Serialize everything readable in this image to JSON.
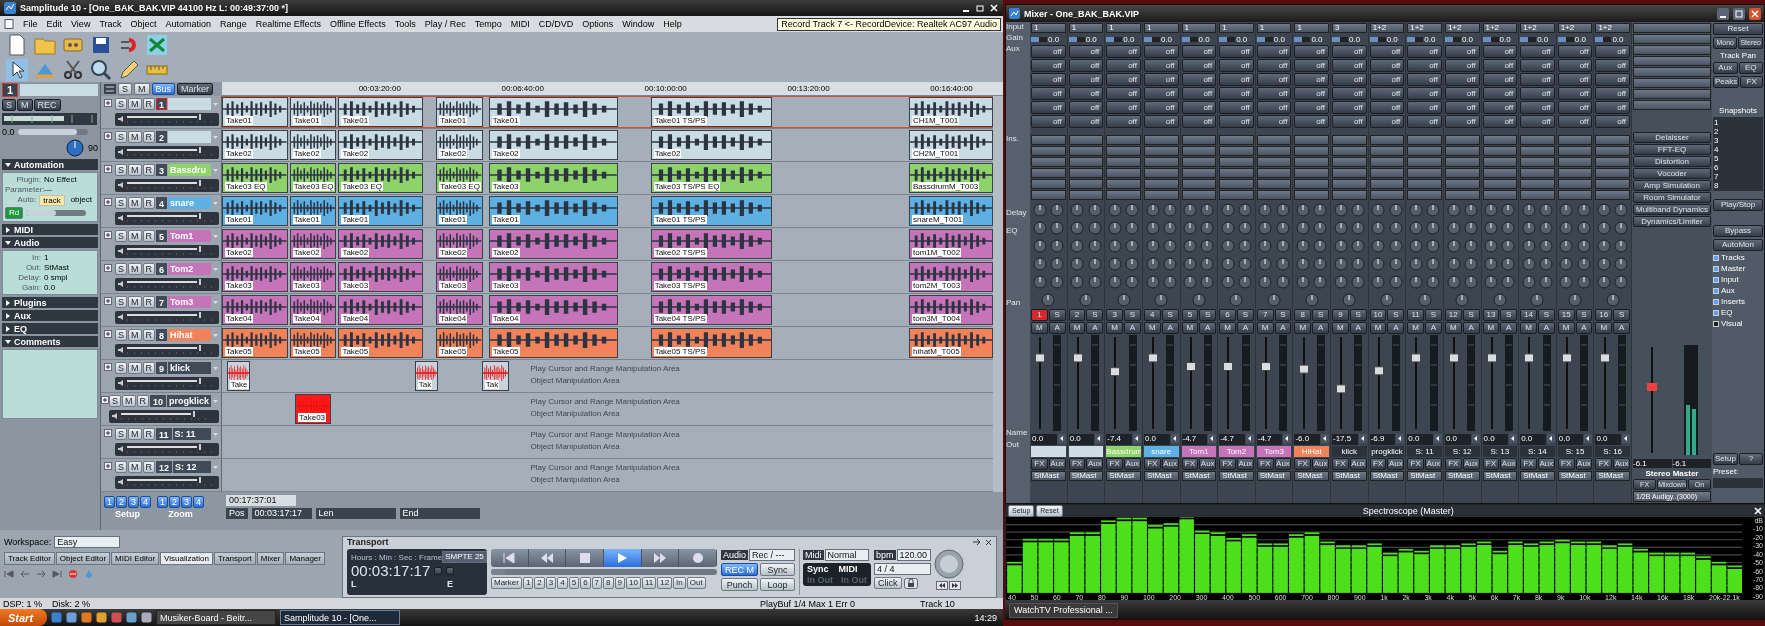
{
  "app": {
    "title": "Samplitude 10 - [One_BAK_BAK.VIP   44100 Hz L: 00:49:37:00 *]",
    "menu": [
      "File",
      "Edit",
      "View",
      "Track",
      "Object",
      "Automation",
      "Range",
      "Realtime Effects",
      "Offline Effects",
      "Tools",
      "Play / Rec",
      "Tempo",
      "MIDI",
      "CD/DVD",
      "Options",
      "Window",
      "Help"
    ],
    "tooltip": "Record Track 7  <-  RecordDevice: Realtek AC97 Audio"
  },
  "track_manager": {
    "track_number": "1",
    "buttons": [
      "S",
      "M",
      "REC"
    ],
    "volume": "0.0",
    "volume_slider": {
      "level": 0.85
    },
    "pan": "90",
    "record_button": "Rd",
    "sections": [
      {
        "title": "Automation",
        "expanded": true,
        "fields": [
          {
            "label": "Plugin:",
            "value": "No Effect"
          },
          {
            "label": "Parameter:",
            "value": "---"
          }
        ],
        "options_label": "Auto:",
        "options": [
          {
            "label": "track",
            "selected": true
          },
          {
            "label": "object",
            "selected": false
          }
        ],
        "slider": {
          "level": 0.5
        }
      },
      {
        "title": "MIDI",
        "expanded": false
      },
      {
        "title": "Audio",
        "expanded": true,
        "fields": [
          {
            "label": "In:",
            "value": "1"
          },
          {
            "label": "Out:",
            "value": "StMast"
          },
          {
            "label": "Delay:",
            "value": "0 smpl"
          },
          {
            "label": "Gain:",
            "value": "0.0"
          }
        ]
      },
      {
        "title": "Plugins",
        "expanded": false
      },
      {
        "title": "Aux",
        "expanded": false
      },
      {
        "title": "EQ",
        "expanded": false
      },
      {
        "title": "Comments",
        "expanded": true
      }
    ]
  },
  "track_header": {
    "buttons": [
      {
        "label": "S",
        "selected": false
      },
      {
        "label": "M",
        "selected": false
      },
      {
        "label": "Bus",
        "selected": true
      }
    ],
    "marker": "Marker"
  },
  "ruler": [
    "00:03:20:00",
    "00:06:40:00",
    "00:10:00:00",
    "00:13:20:00",
    "00:16:40:00"
  ],
  "tracks": [
    {
      "number": "1",
      "selected": true,
      "color": "#c9dce4",
      "buttons": [
        "S",
        "M",
        "R"
      ],
      "clips": [
        {
          "label": "Take01"
        },
        {
          "label": "Take01"
        },
        {
          "label": "Take01"
        },
        {
          "label": "Take01"
        },
        {
          "label": "Take01"
        },
        {
          "label": "Take01  TS/PS"
        },
        {
          "label": "CH1M_T001"
        }
      ]
    },
    {
      "number": "2",
      "selected": false,
      "color": "#c9dce4",
      "buttons": [
        "S",
        "M",
        "R"
      ],
      "clips": [
        {
          "label": "Take02"
        },
        {
          "label": "Take02"
        },
        {
          "label": "Take02"
        },
        {
          "label": "Take02"
        },
        {
          "label": "Take02"
        },
        {
          "label": "Take02"
        },
        {
          "label": "CH2M_T001"
        }
      ]
    },
    {
      "number": "3",
      "name": "Bassdru",
      "selected": false,
      "color": "#8ed26a",
      "buttons": [
        "S",
        "M",
        "R"
      ],
      "clips": [
        {
          "label": "Take03  EQ"
        },
        {
          "label": "Take03  EQ"
        },
        {
          "label": "Take03  EQ"
        },
        {
          "label": "Take03  EQ"
        },
        {
          "label": "Take03"
        },
        {
          "label": "Take03  TS/PS  EQ"
        },
        {
          "label": "BassdrumM_T003"
        }
      ]
    },
    {
      "number": "4",
      "name": "snare",
      "selected": false,
      "color": "#5cb0e2",
      "buttons": [
        "S",
        "M",
        "R"
      ],
      "clips": [
        {
          "label": "Take01"
        },
        {
          "label": "Take01"
        },
        {
          "label": "Take01"
        },
        {
          "label": "Take01"
        },
        {
          "label": "Take01"
        },
        {
          "label": "Take01  TS/PS"
        },
        {
          "label": "snareM_T001"
        }
      ]
    },
    {
      "number": "5",
      "name": "Tom1",
      "selected": false,
      "color": "#c674b9",
      "buttons": [
        "S",
        "M",
        "R"
      ],
      "clips": [
        {
          "label": "Take02"
        },
        {
          "label": "Take02"
        },
        {
          "label": "Take02"
        },
        {
          "label": "Take02"
        },
        {
          "label": "Take02"
        },
        {
          "label": "Take02  TS/PS"
        },
        {
          "label": "tom1M_T002"
        }
      ]
    },
    {
      "number": "6",
      "name": "Tom2",
      "selected": false,
      "color": "#c674b9",
      "buttons": [
        "S",
        "M",
        "R"
      ],
      "clips": [
        {
          "label": "Take03"
        },
        {
          "label": "Take03"
        },
        {
          "label": "Take03"
        },
        {
          "label": "Take03"
        },
        {
          "label": "Take03"
        },
        {
          "label": "Take03  TS/PS"
        },
        {
          "label": "tom2M_T003"
        }
      ]
    },
    {
      "number": "7",
      "name": "Tom3",
      "selected": false,
      "color": "#c674b9",
      "buttons": [
        "S",
        "M",
        "R"
      ],
      "clips": [
        {
          "label": "Take04"
        },
        {
          "label": "Take04"
        },
        {
          "label": "Take04"
        },
        {
          "label": "Take04"
        },
        {
          "label": "Take04"
        },
        {
          "label": "Take04  TS/PS"
        },
        {
          "label": "tom3M_T004"
        }
      ]
    },
    {
      "number": "8",
      "name": "Hihat",
      "selected": false,
      "color": "#f2825a",
      "buttons": [
        "S",
        "M",
        "R"
      ],
      "clips": [
        {
          "label": "Take05"
        },
        {
          "label": "Take05"
        },
        {
          "label": "Take05"
        },
        {
          "label": "Take05"
        },
        {
          "label": "Take05"
        },
        {
          "label": "Take05  TS/PS"
        },
        {
          "label": "hihatM_T005"
        }
      ]
    },
    {
      "number": "9",
      "name": "klick",
      "selected": false,
      "buttons": [
        "S",
        "M",
        "R"
      ],
      "hint": [
        "Play Cursor and Range Manipulation Area",
        "Object Manipulation Area"
      ],
      "clips": [
        {
          "label": "Take"
        },
        {
          "label": "Tak"
        },
        {
          "label": "Tak"
        }
      ]
    },
    {
      "number": "10",
      "name": "progklick",
      "selected": false,
      "buttons": [
        "S",
        "M",
        "R"
      ],
      "hint": [
        "Play Cursor and Range Manipulation Area",
        "Object Manipulation Area"
      ],
      "clips": [
        {
          "label": "Take03"
        }
      ]
    },
    {
      "number": "11",
      "name": "S: 11",
      "selected": false,
      "buttons": [
        "S",
        "M",
        "R"
      ],
      "hint": [
        "Play Cursor and Range Manipulation Area",
        "Object Manipulation Area"
      ]
    },
    {
      "number": "12",
      "name": "S: 12",
      "selected": false,
      "buttons": [
        "S",
        "M",
        "R"
      ],
      "hint": [
        "Play Cursor and Range Manipulation Area",
        "Object Manipulation Area"
      ]
    }
  ],
  "setup": {
    "buttons": [
      "1",
      "2",
      "3",
      "4"
    ],
    "label": "Setup"
  },
  "zoom": {
    "buttons": [
      "1",
      "2",
      "3",
      "4"
    ],
    "label": "Zoom"
  },
  "position": {
    "length": "00:17:37:01",
    "pos_label": "Pos",
    "pos": "00:03:17:17",
    "len_label": "Len",
    "end_label": "End"
  },
  "workspace": {
    "label": "Workspace:",
    "value": "Easy"
  },
  "view_tabs": [
    {
      "label": "Track Editor",
      "selected": false
    },
    {
      "label": "Object Editor",
      "selected": false
    },
    {
      "label": "MIDI Editor",
      "selected": false
    },
    {
      "label": "Visualization",
      "selected": true
    },
    {
      "label": "Transport",
      "selected": false
    },
    {
      "label": "Mixer",
      "selected": false
    },
    {
      "label": "Manager",
      "selected": false
    }
  ],
  "transport": {
    "title": "Transport",
    "units": "Hours : Min : Sec : Frame",
    "format": "SMPTE 25",
    "time": "00:03:17:17",
    "left": "L",
    "right": "E",
    "buttons": [
      {
        "kind": "to-start",
        "active": false
      },
      {
        "kind": "rewind",
        "active": false
      },
      {
        "kind": "stop",
        "active": false
      },
      {
        "kind": "play",
        "active": true
      },
      {
        "kind": "forward",
        "active": false
      },
      {
        "kind": "record",
        "active": false
      }
    ],
    "position": {
      "level": 0.06
    },
    "marker": "Marker",
    "markers": [
      "1",
      "2",
      "3",
      "4",
      "5",
      "6",
      "7",
      "8",
      "9",
      "10",
      "11",
      "12",
      "In",
      "Out"
    ],
    "audio_label": "Audio",
    "audio_mode": "Rec / ---",
    "modes": [
      {
        "label": "REC M",
        "on": true
      },
      {
        "label": "Sync",
        "on": false
      },
      {
        "label": "Punch",
        "on": false
      },
      {
        "label": "Loop",
        "on": false
      }
    ],
    "midi_label": "Midi",
    "midi_mode": "Normal",
    "sync": [
      "Sync",
      "MIDI"
    ],
    "io": [
      "In Out",
      "In Out"
    ],
    "bpm_label": "bpm",
    "bpm": "120.00",
    "signature": "4 / 4",
    "click": "Click"
  },
  "status_bar": {
    "dsp": "DSP: 1 %",
    "disk": "Disk: 2 %",
    "buffer": "PlayBuf 1/4  Max 1  Err 0",
    "track": "Track 10"
  },
  "taskbar": {
    "start": "Start",
    "tasks": [
      {
        "label": "Musiker-Board - Beitr...",
        "selected": false
      },
      {
        "label": "Samplitude 10 - [One...",
        "selected": true
      }
    ],
    "clock": "14:29"
  },
  "mixer": {
    "title": "Mixer - One_BAK_BAK.VIP",
    "row_labels": {
      "input": "Input",
      "gain": "Gain",
      "aux": "Aux",
      "ins": "Ins.",
      "delay": "Delay",
      "eq": "EQ",
      "pan": "Pan",
      "name": "Name",
      "out": "Out"
    },
    "channels": [
      {
        "number": "1",
        "selected": true,
        "input": "1",
        "gain": "0.0",
        "aux": [
          "off",
          "off",
          "off",
          "off",
          "off",
          "off"
        ],
        "buttons": [
          "S",
          "M",
          "A"
        ],
        "level": 0.78,
        "volume": "0.0",
        "color": "#d0dde6",
        "fx": "FX",
        "aux_button": "Aux",
        "out": "StMast"
      },
      {
        "number": "2",
        "selected": false,
        "input": "1",
        "gain": "0.0",
        "aux": [
          "off",
          "off",
          "off",
          "off",
          "off",
          "off"
        ],
        "buttons": [
          "S",
          "M",
          "A"
        ],
        "level": 0.78,
        "volume": "0.0",
        "color": "#d0dde6",
        "fx": "FX",
        "aux_button": "Aux",
        "out": "StMast"
      },
      {
        "number": "3",
        "selected": false,
        "input": "1",
        "gain": "0.0",
        "aux": [
          "off",
          "off",
          "off",
          "off",
          "off",
          "off"
        ],
        "buttons": [
          "S",
          "M",
          "A"
        ],
        "level": 0.62,
        "volume": "-7.4",
        "name": "Bassdrum",
        "color": "#8ed26a",
        "fx": "FX",
        "aux_button": "Aux",
        "out": "StMast"
      },
      {
        "number": "4",
        "selected": false,
        "input": "1",
        "gain": "0.0",
        "aux": [
          "off",
          "off",
          "off",
          "off",
          "off",
          "off"
        ],
        "buttons": [
          "S",
          "M",
          "A"
        ],
        "level": 0.78,
        "volume": "0.0",
        "name": "snare",
        "color": "#5cb0e2",
        "fx": "FX",
        "aux_button": "Aux",
        "out": "StMast"
      },
      {
        "number": "5",
        "selected": false,
        "input": "1",
        "gain": "0.0",
        "aux": [
          "off",
          "off",
          "off",
          "off",
          "off",
          "off"
        ],
        "buttons": [
          "S",
          "M",
          "A"
        ],
        "level": 0.68,
        "volume": "-4.7",
        "name": "Tom1",
        "color": "#c674b9",
        "fx": "FX",
        "aux_button": "Aux",
        "out": "StMast"
      },
      {
        "number": "6",
        "selected": false,
        "input": "1",
        "gain": "0.0",
        "aux": [
          "off",
          "off",
          "off",
          "off",
          "off",
          "off"
        ],
        "buttons": [
          "S",
          "M",
          "A"
        ],
        "level": 0.68,
        "volume": "-4.7",
        "name": "Tom2",
        "color": "#c674b9",
        "fx": "FX",
        "aux_button": "Aux",
        "out": "StMast"
      },
      {
        "number": "7",
        "selected": false,
        "input": "1",
        "gain": "0.0",
        "aux": [
          "off",
          "off",
          "off",
          "off",
          "off",
          "off"
        ],
        "buttons": [
          "S",
          "M",
          "A"
        ],
        "level": 0.68,
        "volume": "-4.7",
        "name": "Tom3",
        "color": "#c674b9",
        "fx": "FX",
        "aux_button": "Aux",
        "out": "StMast"
      },
      {
        "number": "8",
        "selected": false,
        "input": "1",
        "gain": "0.0",
        "aux": [
          "off",
          "off",
          "off",
          "off",
          "off",
          "off"
        ],
        "buttons": [
          "S",
          "M",
          "A"
        ],
        "level": 0.65,
        "volume": "-6.0",
        "name": "HiHat",
        "color": "#f2825a",
        "fx": "FX",
        "aux_button": "Aux",
        "out": "StMast"
      },
      {
        "number": "9",
        "selected": false,
        "input": "3",
        "gain": "0.0",
        "aux": [
          "off",
          "off",
          "off",
          "off",
          "off",
          "off"
        ],
        "buttons": [
          "S",
          "M",
          "A"
        ],
        "level": 0.42,
        "volume": "-17.5",
        "name": "klick",
        "fx": "FX",
        "aux_button": "Aux",
        "out": "StMast"
      },
      {
        "number": "10",
        "selected": false,
        "input": "1+2",
        "gain": "0.0",
        "aux": [
          "off",
          "off",
          "off",
          "off",
          "off",
          "off"
        ],
        "buttons": [
          "S",
          "M",
          "A"
        ],
        "level": 0.63,
        "volume": "-6.9",
        "name": "progklick",
        "fx": "FX",
        "aux_button": "Aux",
        "out": "StMast"
      },
      {
        "number": "11",
        "selected": false,
        "input": "1+2",
        "gain": "0.0",
        "aux": [
          "off",
          "off",
          "off",
          "off",
          "off",
          "off"
        ],
        "buttons": [
          "S",
          "M",
          "A"
        ],
        "level": 0.78,
        "volume": "0.0",
        "name": "S: 11",
        "fx": "FX",
        "aux_button": "Aux",
        "out": "StMast"
      },
      {
        "number": "12",
        "selected": false,
        "input": "1+2",
        "gain": "0.0",
        "aux": [
          "off",
          "off",
          "off",
          "off",
          "off",
          "off"
        ],
        "buttons": [
          "S",
          "M",
          "A"
        ],
        "level": 0.78,
        "volume": "0.0",
        "name": "S: 12",
        "fx": "FX",
        "aux_button": "Aux",
        "out": "StMast"
      },
      {
        "number": "13",
        "selected": false,
        "input": "1+2",
        "gain": "0.0",
        "aux": [
          "off",
          "off",
          "off",
          "off",
          "off",
          "off"
        ],
        "buttons": [
          "S",
          "M",
          "A"
        ],
        "level": 0.78,
        "volume": "0.0",
        "name": "S: 13",
        "fx": "FX",
        "aux_button": "Aux",
        "out": "StMast"
      },
      {
        "number": "14",
        "selected": false,
        "input": "1+2",
        "gain": "0.0",
        "aux": [
          "off",
          "off",
          "off",
          "off",
          "off",
          "off"
        ],
        "buttons": [
          "S",
          "M",
          "A"
        ],
        "level": 0.78,
        "volume": "0.0",
        "name": "S: 14",
        "fx": "FX",
        "aux_button": "Aux",
        "out": "StMast"
      },
      {
        "number": "15",
        "selected": false,
        "input": "1+2",
        "gain": "0.0",
        "aux": [
          "off",
          "off",
          "off",
          "off",
          "off",
          "off"
        ],
        "buttons": [
          "S",
          "M",
          "A"
        ],
        "level": 0.78,
        "volume": "0.0",
        "name": "S: 15",
        "fx": "FX",
        "aux_button": "Aux",
        "out": "StMast"
      },
      {
        "number": "16",
        "selected": false,
        "input": "1+2",
        "gain": "0.0",
        "aux": [
          "off",
          "off",
          "off",
          "off",
          "off",
          "off"
        ],
        "buttons": [
          "S",
          "M",
          "A"
        ],
        "level": 0.78,
        "volume": "0.0",
        "name": "S: 16",
        "fx": "FX",
        "aux_button": "Aux",
        "out": "StMast"
      }
    ],
    "plugins": [
      "Delaisser",
      "FFT-EQ",
      "Distortion",
      "Vocoder",
      "Amp Simulation",
      "Room Simulator",
      "Multiband Dynamics",
      "Dynamics/Limiter"
    ],
    "master": {
      "name": "Stereo Master",
      "level": 0.62,
      "volumes": [
        "-6.1",
        "-6.1"
      ],
      "buttons": [
        "FX",
        "Mixdown",
        "On"
      ],
      "out": "1/2B Audigy..(3000)"
    },
    "panel": {
      "reset": "Reset",
      "pan_modes": [
        "Mono",
        "Stereo"
      ],
      "pan_caption": "Track Pan",
      "toggles": [
        "Aux",
        "EQ",
        "Peaks",
        "FX"
      ],
      "snapshots_title": "Snapshots",
      "snapshots": [
        "1",
        "2",
        "3",
        "4",
        "5",
        "6",
        "7",
        "8"
      ],
      "play_stop": "Play/Stop",
      "bypass": "Bypass",
      "automon": "AutoMon",
      "view": [
        {
          "label": "Tracks",
          "checked": true
        },
        {
          "label": "Master",
          "checked": true
        },
        {
          "label": "Input",
          "checked": true
        },
        {
          "label": "Aux",
          "checked": true
        },
        {
          "label": "Inserts",
          "checked": true
        },
        {
          "label": "EQ",
          "checked": true
        },
        {
          "label": "Visual",
          "checked": false
        }
      ],
      "setup": "Setup",
      "help": "?",
      "preset": "Preset:"
    }
  },
  "spectroscope": {
    "tabs": [
      "Setup",
      "Reset"
    ],
    "title": "Spectroscope (Master)",
    "freq_labels": [
      "40",
      "50",
      "60",
      "70",
      "80",
      "90",
      "100",
      "200",
      "300",
      "400",
      "500",
      "600",
      "700",
      "800",
      "900",
      "1k",
      "2k",
      "3k",
      "4k",
      "5k",
      "6k",
      "7k",
      "8k",
      "9k",
      "10k",
      "12k",
      "14k",
      "16k",
      "18k",
      "20k-22.1k"
    ],
    "db_labels": [
      "dB",
      "-10",
      "-20",
      "-30",
      "-40",
      "-50",
      "-60",
      "-70",
      "-80",
      "-90"
    ]
  },
  "second_taskbar": {
    "task": "WatchTV Professional ..."
  }
}
